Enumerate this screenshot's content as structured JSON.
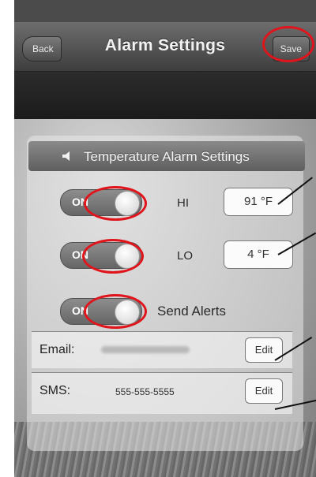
{
  "nav": {
    "title": "Alarm Settings",
    "back_label": "Back",
    "save_label": "Save"
  },
  "section": {
    "title": "Temperature Alarm Settings",
    "icon": "speaker-icon"
  },
  "hi": {
    "toggle_label": "ON",
    "toggle_state": true,
    "label": "HI",
    "value": "91 °F"
  },
  "lo": {
    "toggle_label": "ON",
    "toggle_state": true,
    "label": "LO",
    "value": "4 °F"
  },
  "alerts": {
    "toggle_label": "ON",
    "toggle_state": true,
    "label": "Send Alerts"
  },
  "email": {
    "label": "Email:",
    "edit_label": "Edit"
  },
  "sms": {
    "label": "SMS:",
    "value": "555-555-5555",
    "edit_label": "Edit"
  },
  "colors": {
    "highlight": "#e0141b",
    "nav_bg": "#4e4e4e"
  }
}
